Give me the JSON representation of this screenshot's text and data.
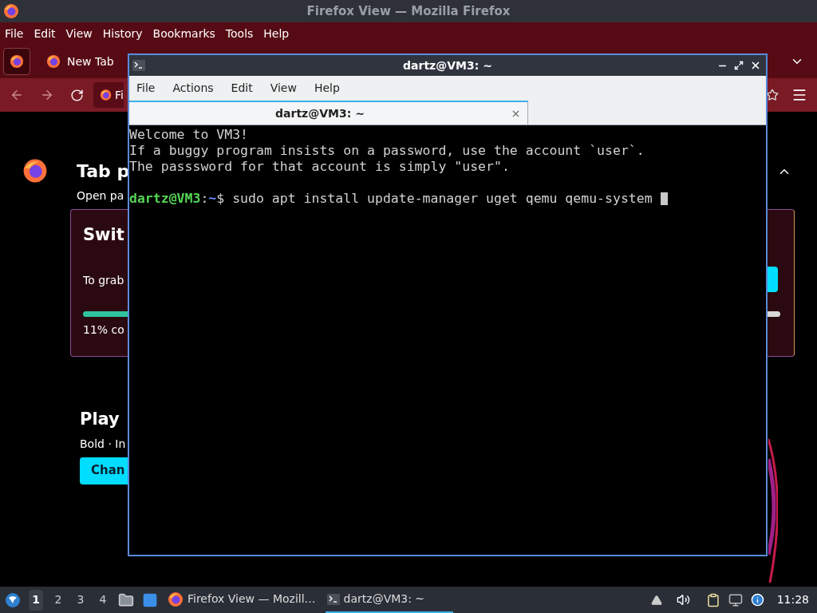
{
  "firefox": {
    "title": "Firefox View — Mozilla Firefox",
    "menu": [
      "File",
      "Edit",
      "View",
      "History",
      "Bookmarks",
      "Tools",
      "Help"
    ],
    "tabs": [
      {
        "kind": "view",
        "selected": true
      },
      {
        "kind": "page",
        "label": "New Tab",
        "selected": false
      }
    ],
    "url": "Fi",
    "page": {
      "heading": "Tab p",
      "subtitle": "Open pa",
      "card": {
        "title": "Swit",
        "text": "To grab",
        "progress_label": "11% co"
      },
      "section": {
        "title": "Play",
        "text": "Bold · In",
        "button": "Chan"
      }
    }
  },
  "terminal": {
    "title": "dartz@VM3: ~",
    "menu": [
      "File",
      "Actions",
      "Edit",
      "View",
      "Help"
    ],
    "tabs": [
      {
        "label": "dartz@VM3: ~",
        "selected": true
      }
    ],
    "lines": [
      "Welcome to VM3!",
      "If a buggy program insists on a password, use the account `user`.",
      "The passsword for that account is simply \"user\"."
    ],
    "prompt": {
      "user_host": "dartz@VM3",
      "separator": ":",
      "path": "~",
      "command": "$ sudo apt install update-manager uget qemu qemu-system "
    }
  },
  "taskbar": {
    "workspaces": [
      {
        "label": "1",
        "selected": true
      },
      {
        "label": "2",
        "selected": false
      },
      {
        "label": "3",
        "selected": false
      },
      {
        "label": "4",
        "selected": false
      }
    ],
    "tasks": [
      {
        "kind": "browser",
        "label": "Firefox View — Mozill…",
        "selected": false
      },
      {
        "kind": "terminal",
        "label": "dartz@VM3: ~",
        "selected": true
      }
    ],
    "clock": "11:28"
  }
}
